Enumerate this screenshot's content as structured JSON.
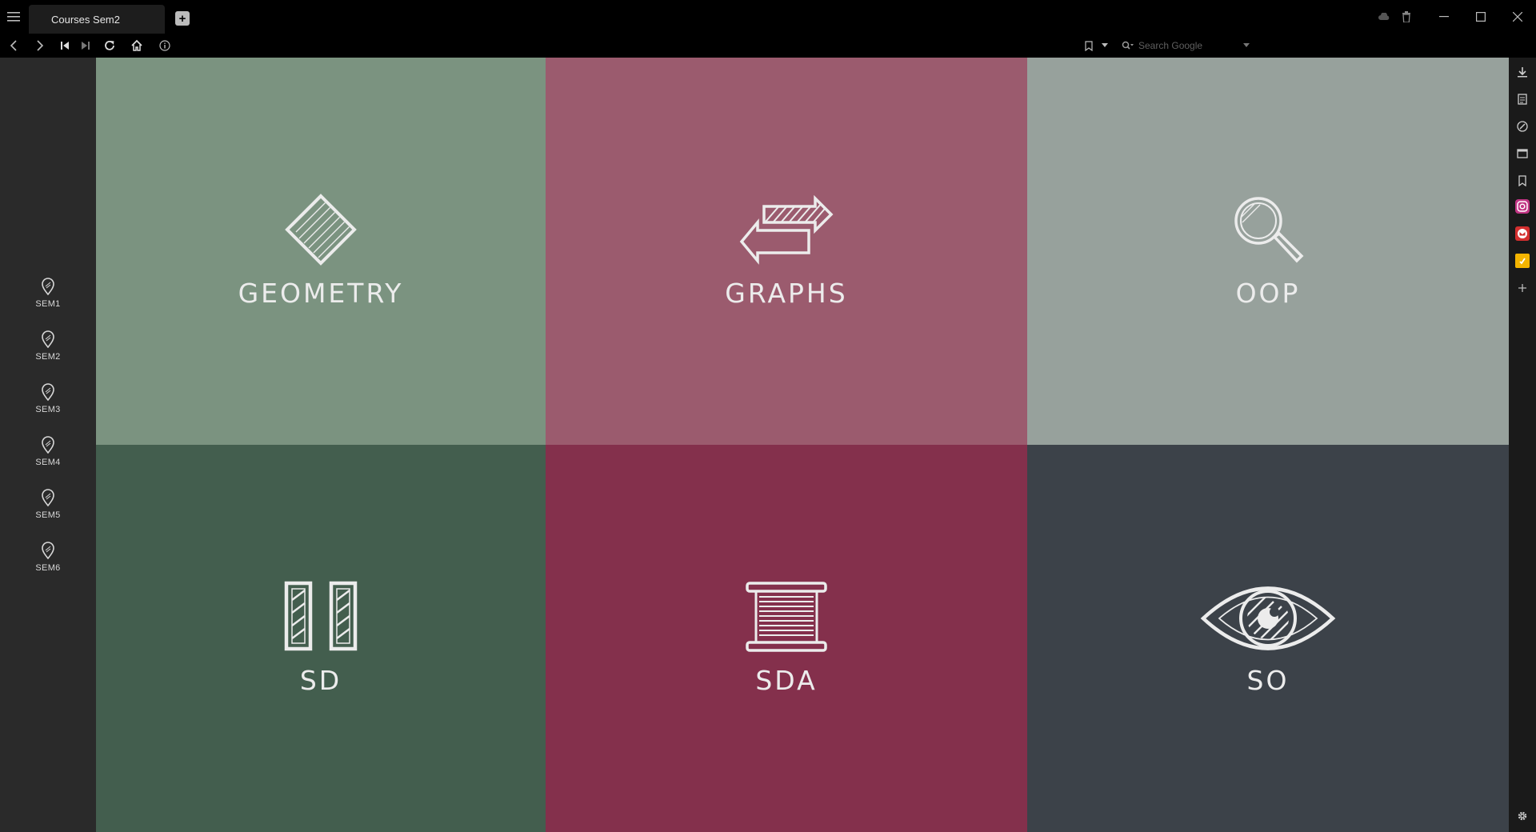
{
  "window": {
    "tab_title": "Courses Sem2",
    "menu_icon": "hamburger-icon",
    "new_tab_icon": "plus-icon"
  },
  "toolbar": {
    "back_icon": "chevron-left-icon",
    "forward_icon": "chevron-right-icon",
    "rewind_icon": "skip-back-icon",
    "fastforward_icon": "skip-forward-icon",
    "reload_icon": "reload-icon",
    "home_icon": "home-icon",
    "info_icon": "info-icon",
    "bookmark_icon": "bookmark-icon",
    "search_placeholder": "Search Google"
  },
  "sidebar": {
    "items": [
      {
        "label": "SEM1",
        "icon": "map-pin-icon"
      },
      {
        "label": "SEM2",
        "icon": "map-pin-icon"
      },
      {
        "label": "SEM3",
        "icon": "map-pin-icon"
      },
      {
        "label": "SEM4",
        "icon": "map-pin-icon"
      },
      {
        "label": "SEM5",
        "icon": "map-pin-icon"
      },
      {
        "label": "SEM6",
        "icon": "map-pin-icon"
      }
    ]
  },
  "tiles": [
    {
      "label": "GEOMETRY",
      "icon": "diamond-icon",
      "color": "#7b9380"
    },
    {
      "label": "GRAPHS",
      "icon": "arrows-exchange-icon",
      "color": "#9b5b6e"
    },
    {
      "label": "OOP",
      "icon": "magnifier-icon",
      "color": "#97a19c"
    },
    {
      "label": "SD",
      "icon": "columns-icon",
      "color": "#435e4e"
    },
    {
      "label": "SDA",
      "icon": "spool-icon",
      "color": "#84304c"
    },
    {
      "label": "SO",
      "icon": "eye-icon",
      "color": "#3c4249"
    }
  ],
  "right_panel": {
    "items": [
      "download-icon",
      "notes-icon",
      "history-icon",
      "window-icon",
      "bookmark-icon",
      "instagram-icon",
      "mail-icon",
      "keep-icon",
      "add-panel-icon"
    ],
    "settings_icon": "gear-icon"
  },
  "colors": {
    "background": "#000000",
    "sidebar": "#2a2a2a",
    "text": "#ececec"
  }
}
